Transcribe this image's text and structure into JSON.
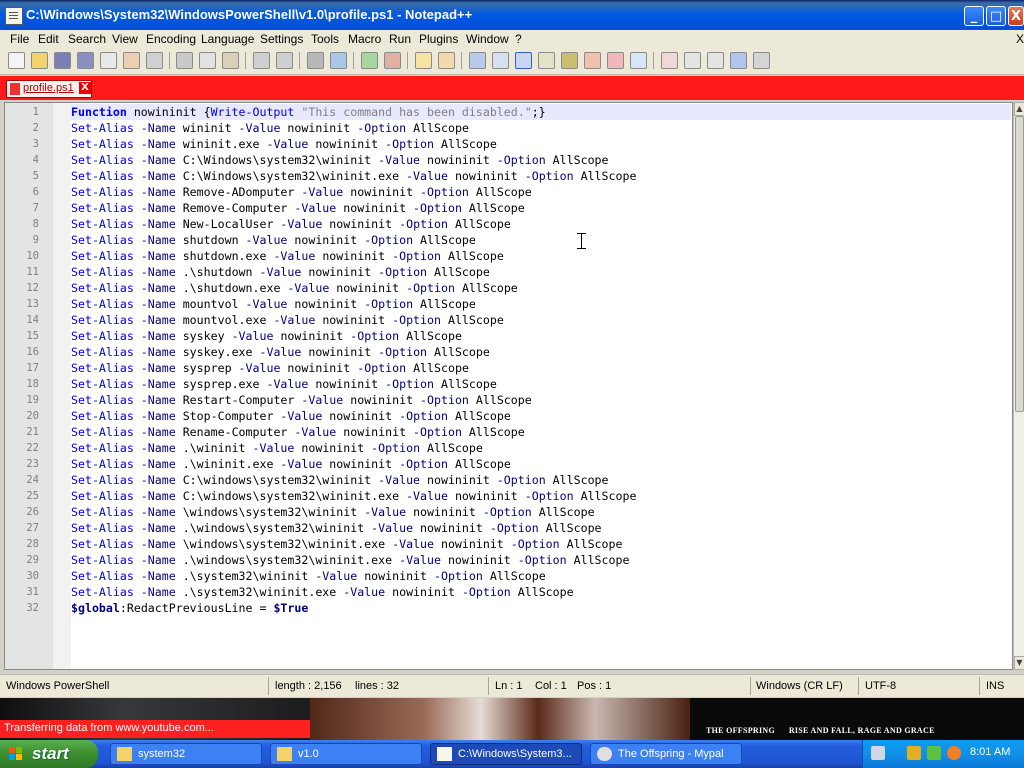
{
  "window": {
    "title": "C:\\Windows\\System32\\WindowsPowerShell\\v1.0\\profile.ps1 - Notepad++",
    "min": "_",
    "max": "□",
    "close": "X"
  },
  "menu": [
    "File",
    "Edit",
    "Search",
    "View",
    "Encoding",
    "Language",
    "Settings",
    "Tools",
    "Macro",
    "Run",
    "Plugins",
    "Window",
    "?"
  ],
  "menu_close": "X",
  "tab": {
    "label": "profile.ps1",
    "close": "X"
  },
  "editor": {
    "line_numbers": [
      "1",
      "2",
      "3",
      "4",
      "5",
      "6",
      "7",
      "8",
      "9",
      "10",
      "11",
      "12",
      "13",
      "14",
      "15",
      "16",
      "17",
      "18",
      "19",
      "20",
      "21",
      "22",
      "23",
      "24",
      "25",
      "26",
      "27",
      "28",
      "29",
      "30",
      "31",
      "32"
    ],
    "line1": {
      "kw": "Function",
      "name": " nowininit ",
      "brace_open": "{",
      "cmd": "Write-Output",
      "sp": " ",
      "str": "\"This command has been disabled.\"",
      "end": ";}"
    },
    "alias_lines": [
      {
        "name": "wininit"
      },
      {
        "name": "wininit.exe"
      },
      {
        "name": "C:\\Windows\\system32\\wininit"
      },
      {
        "name": "C:\\Windows\\system32\\wininit.exe"
      },
      {
        "name": "Remove-ADomputer"
      },
      {
        "name": "Remove-Computer"
      },
      {
        "name": "New-LocalUser"
      },
      {
        "name": "shutdown"
      },
      {
        "name": "shutdown.exe"
      },
      {
        "name": ".\\shutdown"
      },
      {
        "name": ".\\shutdown.exe"
      },
      {
        "name": "mountvol"
      },
      {
        "name": "mountvol.exe"
      },
      {
        "name": "syskey"
      },
      {
        "name": "syskey.exe"
      },
      {
        "name": "sysprep"
      },
      {
        "name": "sysprep.exe"
      },
      {
        "name": "Restart-Computer"
      },
      {
        "name": "Stop-Computer"
      },
      {
        "name": "Rename-Computer"
      },
      {
        "name": ".\\wininit"
      },
      {
        "name": ".\\wininit.exe"
      },
      {
        "name": "C:\\windows\\system32\\wininit"
      },
      {
        "name": "C:\\windows\\system32\\wininit.exe"
      },
      {
        "name": "\\windows\\system32\\wininit"
      },
      {
        "name": ".\\windows\\system32\\wininit"
      },
      {
        "name": "\\windows\\system32\\wininit.exe"
      },
      {
        "name": ".\\windows\\system32\\wininit.exe"
      },
      {
        "name": ".\\system32\\wininit"
      },
      {
        "name": ".\\system32\\wininit.exe"
      }
    ],
    "alias_parts": {
      "cmd": "Set-Alias",
      "name_flag": " -Name ",
      "value_flag": " -Value ",
      "value": "nowininit",
      "option_flag": " -Option ",
      "option": "AllScope"
    },
    "last_line": {
      "var": "$global",
      "colon": ":",
      "prop": "RedactPreviousLine",
      "eq": " = ",
      "val": "$True"
    }
  },
  "scroll": {
    "up": "▲",
    "down": "▼"
  },
  "status": {
    "language": "Windows PowerShell",
    "length": "length : 2,156",
    "lines": "lines : 32",
    "ln": "Ln : 1",
    "col": "Col : 1",
    "pos": "Pos : 1",
    "eol": "Windows (CR LF)",
    "encoding": "UTF-8",
    "mode": "INS"
  },
  "background": {
    "transfer": "Transferring data from www.youtube.com...",
    "banner": "THE OFFSPRING      RISE AND FALL, RAGE AND GRACE"
  },
  "taskbar": {
    "start": "start",
    "tasks": [
      "system32",
      "v1.0",
      "C:\\Windows\\System3...",
      "The Offspring - Mypal"
    ],
    "clock": "8:01 AM"
  },
  "colors": {
    "tab_bar": "#ff1a1a",
    "keyword": "#0000ff",
    "string": "#808080",
    "taskbar": "#245edb",
    "start": "#3c8d2f"
  }
}
